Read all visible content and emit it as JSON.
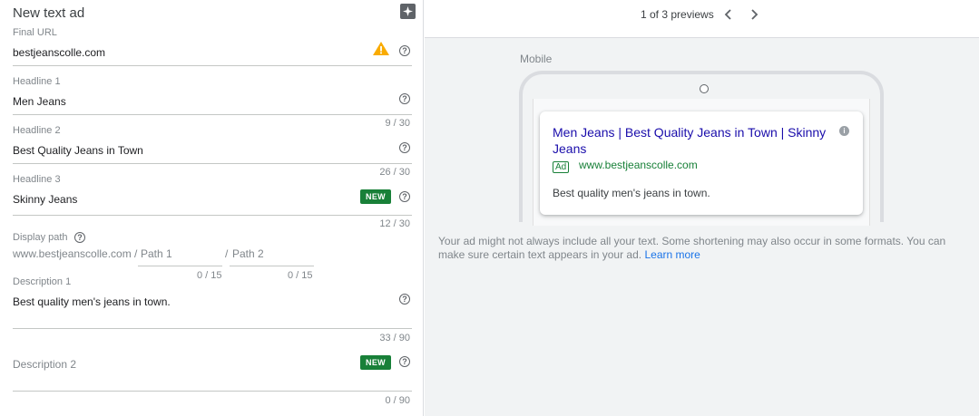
{
  "form": {
    "title": "New text ad",
    "final_url": {
      "label": "Final URL",
      "value": "bestjeanscolle.com"
    },
    "headline1": {
      "label": "Headline 1",
      "value": "Men Jeans",
      "counter": "9 / 30"
    },
    "headline2": {
      "label": "Headline 2",
      "value": "Best Quality Jeans in Town",
      "counter": "26 / 30"
    },
    "headline3": {
      "label": "Headline 3",
      "value": "Skinny Jeans",
      "counter": "12 / 30",
      "badge": "NEW"
    },
    "display_path": {
      "label": "Display path",
      "base": "www.bestjeanscolle.com /",
      "path1_placeholder": "Path 1",
      "sep": "/",
      "path2_placeholder": "Path 2",
      "path1_counter": "0 / 15",
      "path2_counter": "0 / 15"
    },
    "description1": {
      "label": "Description 1",
      "value": "Best quality men's jeans in town.",
      "counter": "33 / 90"
    },
    "description2": {
      "label": "Description 2",
      "value": "",
      "counter": "0 / 90",
      "badge": "NEW"
    }
  },
  "preview": {
    "count_text": "1 of 3 previews",
    "prev_icon": "‹",
    "next_icon": "›",
    "device_label": "Mobile",
    "ad": {
      "headline": "Men Jeans | Best Quality Jeans in Town | Skinny Jeans",
      "badge": "Ad",
      "url": "www.bestjeanscolle.com",
      "description": "Best quality men's jeans in town."
    },
    "note": "Your ad might not always include all your text. Some shortening may also occur in some formats. You can make sure certain text appears in your ad.",
    "learn_more": "Learn more"
  },
  "colors": {
    "accent_blue": "#1a73e8",
    "ad_green": "#188038",
    "warning": "#f9ab00",
    "headline_link": "#1a0dab"
  },
  "icons": {
    "ai": "sparkle-icon",
    "warning": "warning-icon",
    "help": "help-icon",
    "info": "info-icon"
  }
}
